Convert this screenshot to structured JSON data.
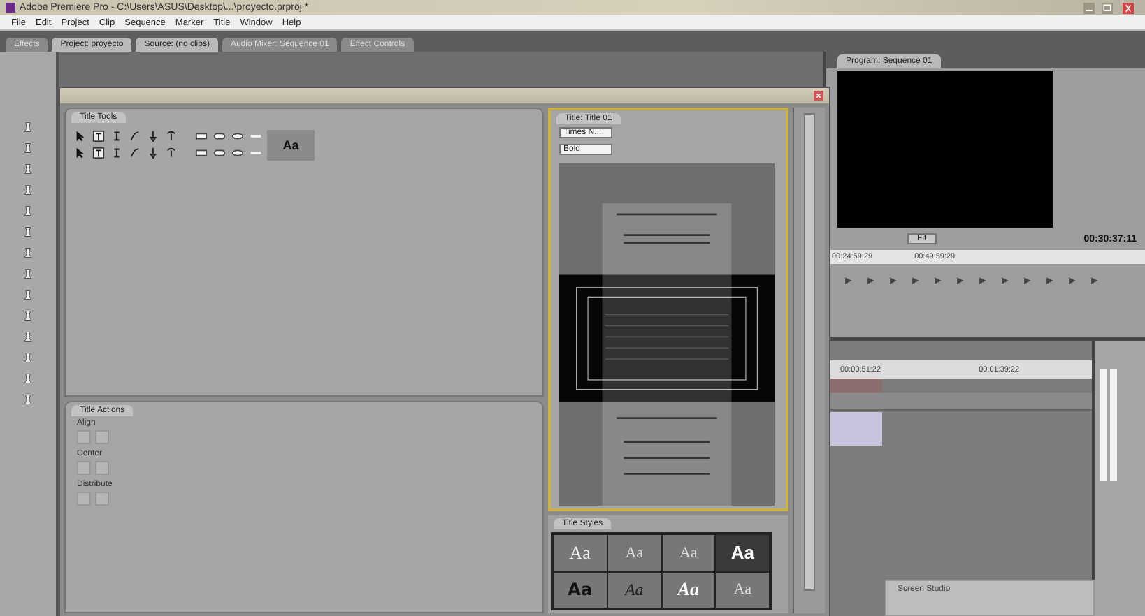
{
  "window": {
    "title": "Adobe Premiere Pro - C:\\Users\\ASUS\\Desktop\\...\\proyecto.prproj *"
  },
  "menu": [
    "File",
    "Edit",
    "Project",
    "Clip",
    "Sequence",
    "Marker",
    "Title",
    "Window",
    "Help"
  ],
  "tabs": [
    {
      "label": "Effects",
      "selected": false
    },
    {
      "label": "Project: proyecto",
      "selected": true
    },
    {
      "label": "Source: (no clips)",
      "selected": true
    },
    {
      "label": "Audio Mixer: Sequence 01",
      "selected": false
    },
    {
      "label": "Effect Controls",
      "selected": false
    }
  ],
  "program": {
    "tab": "Program: Sequence 01",
    "zoom": "Fit",
    "timecode": "00:30:37:11",
    "ruler": [
      "00:24:59:29",
      "00:49:59:29"
    ]
  },
  "timeline": {
    "times": [
      "00:00:51:22",
      "00:01:39:22"
    ]
  },
  "title_designer": {
    "tools_tab": "Title Tools",
    "sample": "Aa",
    "actions_tab": "Title Actions",
    "actions_groups": [
      "Align",
      "Center",
      "Distribute"
    ],
    "title_tab": "Title: Title 01",
    "font": "Times N...",
    "style": "Bold",
    "styles_tab": "Title Styles",
    "styles": [
      {
        "sample": "Aa",
        "kind": "serif"
      },
      {
        "sample": "Aa",
        "kind": "thin"
      },
      {
        "sample": "Aa",
        "kind": "thin"
      },
      {
        "sample": "Aa",
        "kind": "bold"
      },
      {
        "sample": "Aa",
        "kind": "heavy"
      },
      {
        "sample": "Aa",
        "kind": "script"
      },
      {
        "sample": "Aa",
        "kind": "italic"
      },
      {
        "sample": "Aa",
        "kind": "thin"
      }
    ]
  },
  "notification": {
    "title": "Screen Studio"
  }
}
